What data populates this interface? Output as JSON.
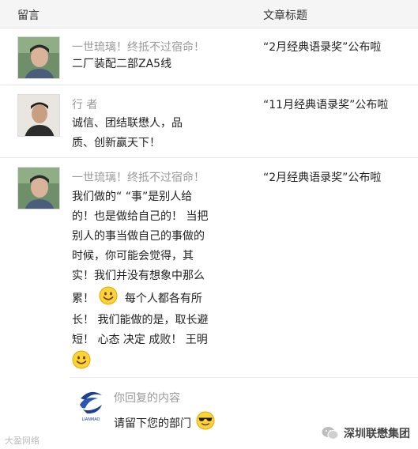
{
  "header": {
    "col_message": "留言",
    "col_article": "文章标题"
  },
  "comments": [
    {
      "author": "一世琉璃！终抵不过宿命！",
      "lines": [
        "二厂装配二部ZA5线"
      ],
      "article": "“2月经典语录奖”公布啦"
    },
    {
      "author": "行 者",
      "lines": [
        "诚信、团结联懋人，品",
        "质、创新赢天下！"
      ],
      "article": "“11月经典语录奖”公布啦"
    },
    {
      "author": "一世琉璃！终抵不过宿命！",
      "lines": [
        "我们做的“ “事”是别人给",
        "的！也是做给自己的！ 当把",
        "别人的事当做自己的事做的",
        "时候，你可能会觉得，其",
        "实！我们并没有想象中那么",
        "累！",
        "每个人都各有所",
        "长！ 我们能做的是，取长避",
        "短！ 心态 决定 成败！ 王明"
      ],
      "article": "“2月经典语录奖”公布啦"
    }
  ],
  "reply": {
    "label": "你回复的内容",
    "text": "请留下您的部门",
    "logo_text": "LIANMAO"
  },
  "watermarks": {
    "left": "大盈网络",
    "right": "深圳联懋集团"
  },
  "icons": [
    "smile-emoji-icon",
    "cool-emoji-icon",
    "wechat-icon"
  ]
}
